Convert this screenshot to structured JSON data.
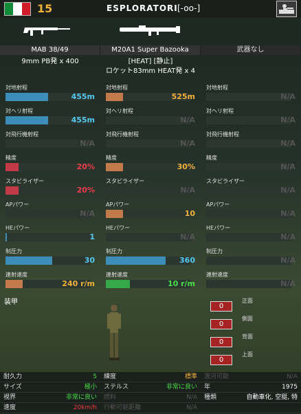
{
  "unit": {
    "cost": "15",
    "name": "ESPLORATORI",
    "symbol": "[-oo-]",
    "flag": [
      "#138a37",
      "#ffffff",
      "#d21b28"
    ]
  },
  "weapons": [
    {
      "name": "MAB 38/49",
      "ammo1": "",
      "ammo2": "9mm PB発 x 400"
    },
    {
      "name": "M20A1 Super Bazooka",
      "ammo1": "[HEAT] [静止]",
      "ammo2": "ロケット83mm HEAT発 x 4"
    },
    {
      "name": "武器なし",
      "ammo1": "",
      "ammo2": ""
    }
  ],
  "stats": [
    [
      {
        "label": "対地射程",
        "value": "455m",
        "fill": 0.5,
        "color": "#3c8eb8",
        "vcolor": "#55c8f0"
      },
      {
        "label": "対ヘリ射程",
        "value": "455m",
        "fill": 0.5,
        "color": "#3c8eb8",
        "vcolor": "#55c8f0"
      },
      {
        "label": "対飛行機射程",
        "value": "N/A",
        "fill": 0,
        "color": "#3c8eb8",
        "vcolor": "#555"
      },
      {
        "label": "精度",
        "value": "20%",
        "fill": 0.15,
        "color": "#c23a45",
        "vcolor": "#ef3b4b"
      },
      {
        "label": "スタビライザー",
        "value": "20%",
        "fill": 0.15,
        "color": "#c23a45",
        "vcolor": "#ef3b4b"
      },
      {
        "label": "APパワー",
        "value": "N/A",
        "fill": 0,
        "color": "#3c8eb8",
        "vcolor": "#555"
      },
      {
        "label": "HEパワー",
        "value": "1",
        "fill": 0.02,
        "color": "#3c8eb8",
        "vcolor": "#55c8f0"
      },
      {
        "label": "制圧力",
        "value": "30",
        "fill": 0.55,
        "color": "#3c8eb8",
        "vcolor": "#55c8f0"
      },
      {
        "label": "連射速度",
        "value": "240 r/m",
        "fill": 0.2,
        "color": "#c27a4a",
        "vcolor": "#f0b13a"
      }
    ],
    [
      {
        "label": "対地射程",
        "value": "525m",
        "fill": 0.2,
        "color": "#c27a4a",
        "vcolor": "#f0b13a"
      },
      {
        "label": "対ヘリ射程",
        "value": "N/A",
        "fill": 0,
        "color": "#3c8eb8",
        "vcolor": "#555"
      },
      {
        "label": "対飛行機射程",
        "value": "N/A",
        "fill": 0,
        "color": "#3c8eb8",
        "vcolor": "#555"
      },
      {
        "label": "精度",
        "value": "30%",
        "fill": 0.2,
        "color": "#c27a4a",
        "vcolor": "#f0b13a"
      },
      {
        "label": "スタビライザー",
        "value": "N/A",
        "fill": 0,
        "color": "#3c8eb8",
        "vcolor": "#555"
      },
      {
        "label": "APパワー",
        "value": "10",
        "fill": 0.2,
        "color": "#c27a4a",
        "vcolor": "#f0b13a"
      },
      {
        "label": "HEパワー",
        "value": "N/A",
        "fill": 0,
        "color": "#3c8eb8",
        "vcolor": "#555"
      },
      {
        "label": "制圧力",
        "value": "360",
        "fill": 0.7,
        "color": "#3c8eb8",
        "vcolor": "#55c8f0"
      },
      {
        "label": "連射速度",
        "value": "10 r/m",
        "fill": 0.28,
        "color": "#35a84a",
        "vcolor": "#4adf4a"
      }
    ],
    [
      {
        "label": "対地射程",
        "value": "N/A",
        "fill": 0,
        "color": "#3c8eb8",
        "vcolor": "#555"
      },
      {
        "label": "対ヘリ射程",
        "value": "N/A",
        "fill": 0,
        "color": "#3c8eb8",
        "vcolor": "#555"
      },
      {
        "label": "対飛行機射程",
        "value": "N/A",
        "fill": 0,
        "color": "#3c8eb8",
        "vcolor": "#555"
      },
      {
        "label": "精度",
        "value": "N/A",
        "fill": 0,
        "color": "#3c8eb8",
        "vcolor": "#555"
      },
      {
        "label": "スタビライザー",
        "value": "N/A",
        "fill": 0,
        "color": "#3c8eb8",
        "vcolor": "#555"
      },
      {
        "label": "APパワー",
        "value": "N/A",
        "fill": 0,
        "color": "#3c8eb8",
        "vcolor": "#555"
      },
      {
        "label": "HEパワー",
        "value": "N/A",
        "fill": 0,
        "color": "#3c8eb8",
        "vcolor": "#555"
      },
      {
        "label": "制圧力",
        "value": "N/A",
        "fill": 0,
        "color": "#3c8eb8",
        "vcolor": "#555"
      },
      {
        "label": "連射速度",
        "value": "N/A",
        "fill": 0,
        "color": "#3c8eb8",
        "vcolor": "#555"
      }
    ]
  ],
  "armor": {
    "title": "装甲",
    "values": [
      {
        "label": "正面",
        "value": "0"
      },
      {
        "label": "側面",
        "value": "0"
      },
      {
        "label": "背面",
        "value": "0"
      },
      {
        "label": "上面",
        "value": "0"
      }
    ]
  },
  "info": [
    [
      {
        "l": "耐久力",
        "v": "5",
        "c": "g"
      },
      {
        "l": "練度",
        "v": "標準",
        "c": "o"
      },
      {
        "l": "渡河可能",
        "v": "N/A",
        "c": "dim",
        "ld": true
      }
    ],
    [
      {
        "l": "サイズ",
        "v": "極小",
        "c": "g"
      },
      {
        "l": "ステルス",
        "v": "非常に良い",
        "c": "g"
      },
      {
        "l": "年",
        "v": "1975",
        "c": "w"
      }
    ],
    [
      {
        "l": "視界",
        "v": "非常に良い",
        "c": "g"
      },
      {
        "l": "燃料",
        "v": "N/A",
        "c": "dim",
        "ld": true
      },
      {
        "l": "種類",
        "v": "自動車化, 空挺, 特",
        "c": "w"
      }
    ],
    [
      {
        "l": "速度",
        "v": "20km/h",
        "c": "r"
      },
      {
        "l": "行動可能距離",
        "v": "N/A",
        "c": "dim",
        "ld": true
      },
      {
        "l": "",
        "v": "",
        "c": "w"
      }
    ]
  ]
}
